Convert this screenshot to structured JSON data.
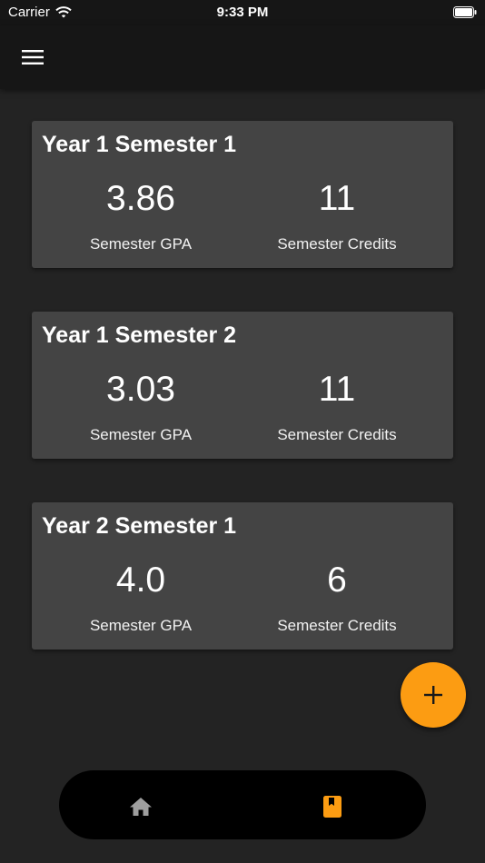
{
  "status_bar": {
    "carrier": "Carrier",
    "time": "9:33 PM"
  },
  "app_bar": {
    "menu_icon": "hamburger-menu-icon"
  },
  "semesters": [
    {
      "title": "Year 1 Semester 1",
      "gpa": "3.86",
      "gpa_label": "Semester GPA",
      "credits": "11",
      "credits_label": "Semester Credits"
    },
    {
      "title": "Year 1 Semester 2",
      "gpa": "3.03",
      "gpa_label": "Semester GPA",
      "credits": "11",
      "credits_label": "Semester Credits"
    },
    {
      "title": "Year 2 Semester 1",
      "gpa": "4.0",
      "gpa_label": "Semester GPA",
      "credits": "6",
      "credits_label": "Semester Credits"
    }
  ],
  "fab": {
    "icon": "plus-icon"
  },
  "bottom_nav": {
    "items": [
      {
        "icon": "home-icon",
        "active": false
      },
      {
        "icon": "bookmark-book-icon",
        "active": true
      }
    ]
  },
  "colors": {
    "background": "#232323",
    "bar": "#161616",
    "card": "#444444",
    "accent": "#fc9c12",
    "nav_inactive": "#9e9e9e"
  }
}
